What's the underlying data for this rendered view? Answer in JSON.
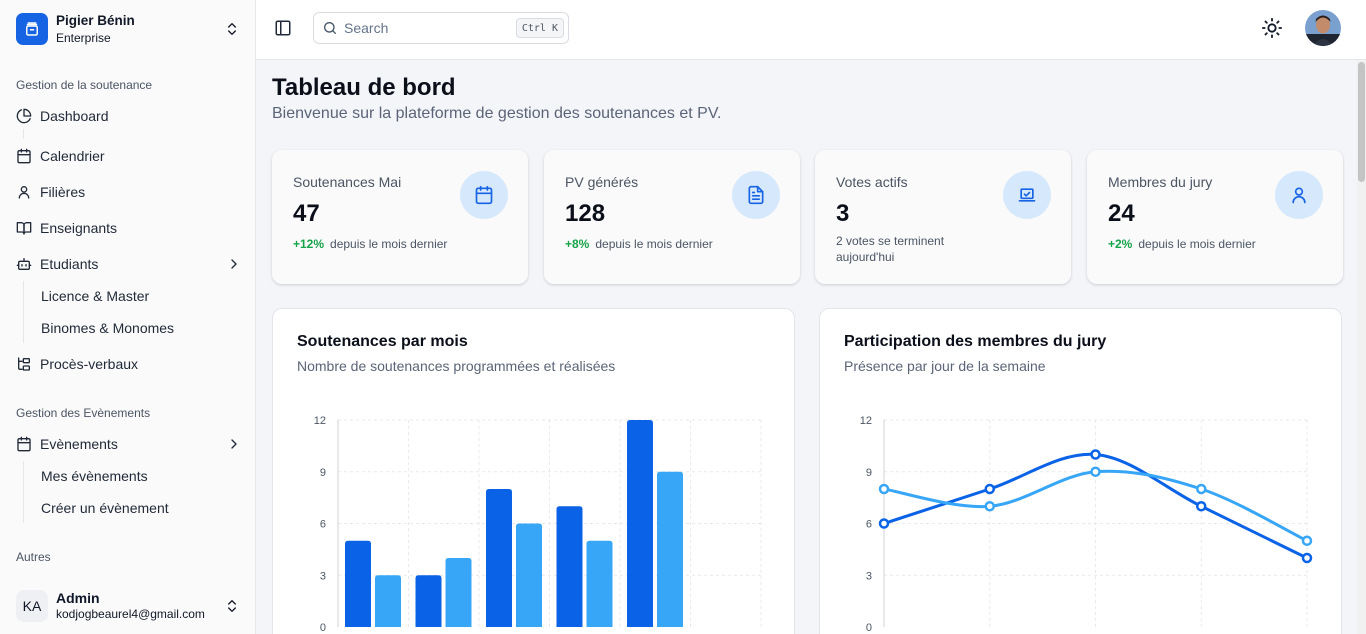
{
  "sidebar": {
    "org_name": "Pigier Bénin",
    "org_plan": "Enterprise",
    "group1_label": "Gestion de la soutenance",
    "dashboard": "Dashboard",
    "calendar": "Calendrier",
    "filieres": "Filières",
    "teachers": "Enseignants",
    "students": "Etudiants",
    "students_sub": [
      "Licence & Master",
      "Binomes & Monomes"
    ],
    "pv": "Procès-verbaux",
    "group2_label": "Gestion des Evènements",
    "events": "Evènements",
    "events_sub": [
      "Mes évènements",
      "Créer un évènement"
    ],
    "group3_label": "Autres",
    "user_initials": "KA",
    "user_name": "Admin",
    "user_email": "kodjogbeaurel4@gmail.com"
  },
  "header": {
    "search_placeholder": "Search",
    "search_shortcut": "Ctrl K"
  },
  "page": {
    "title": "Tableau de bord",
    "subtitle": "Bienvenue sur la plateforme de gestion des soutenances et PV."
  },
  "stats": [
    {
      "label": "Soutenances Mai",
      "value": "47",
      "trend": "+12%",
      "trend_text": "depuis le mois dernier",
      "icon": "calendar-icon"
    },
    {
      "label": "PV générés",
      "value": "128",
      "trend": "+8%",
      "trend_text": "depuis le mois dernier",
      "icon": "file-text-icon"
    },
    {
      "label": "Votes actifs",
      "value": "3",
      "note": "2 votes se terminent aujourd'hui",
      "icon": "laptop-check-icon"
    },
    {
      "label": "Membres du jury",
      "value": "24",
      "trend": "+2%",
      "trend_text": "depuis le mois dernier",
      "icon": "user-icon"
    }
  ],
  "colors": {
    "primary": "#0a63e6",
    "secondary": "#38a6f7",
    "positive": "#16a34a"
  },
  "chart_data": [
    {
      "type": "bar",
      "title": "Soutenances par mois",
      "subtitle": "Nombre de soutenances programmées et réalisées",
      "ylim": [
        0,
        12
      ],
      "yticks": [
        0,
        3,
        6,
        9,
        12
      ],
      "grid": true,
      "series": [
        {
          "values": [
            5,
            3,
            8,
            7,
            12
          ],
          "color": "#0a63e6"
        },
        {
          "values": [
            3,
            4,
            6,
            5,
            9
          ],
          "color": "#38a6f7"
        }
      ]
    },
    {
      "type": "line",
      "title": "Participation des membres du jury",
      "subtitle": "Présence par jour de la semaine",
      "ylim": [
        0,
        12
      ],
      "yticks": [
        0,
        3,
        6,
        9,
        12
      ],
      "grid": true,
      "series": [
        {
          "values": [
            6,
            8,
            10,
            7,
            4
          ],
          "color": "#0a63e6"
        },
        {
          "values": [
            8,
            7,
            9,
            8,
            5
          ],
          "color": "#38a6f7"
        }
      ]
    }
  ]
}
